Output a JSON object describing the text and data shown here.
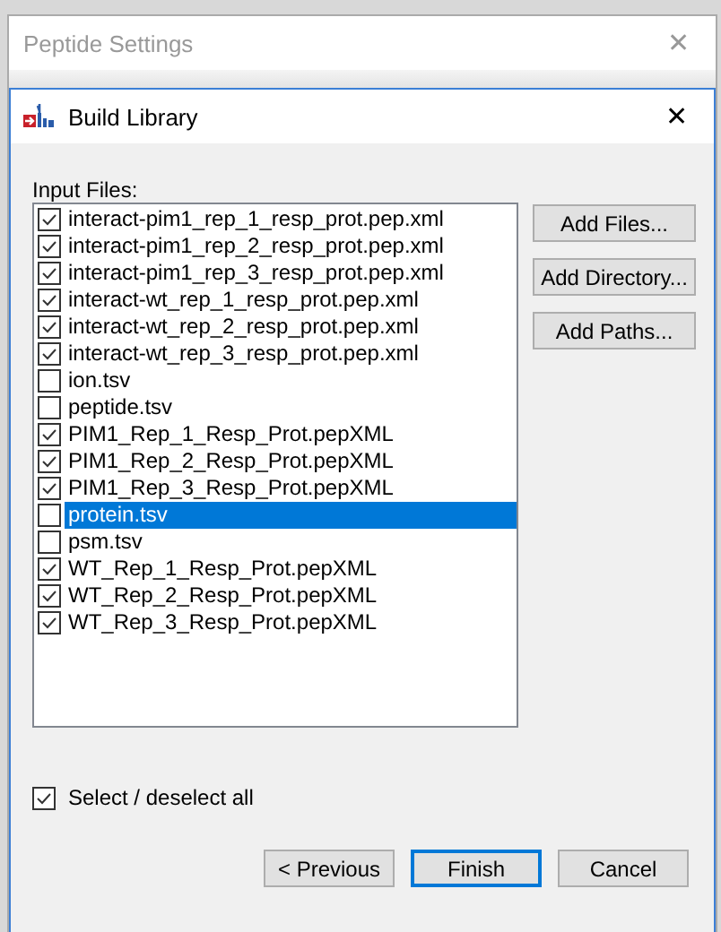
{
  "outer_window": {
    "title": "Peptide Settings",
    "close": "✕"
  },
  "dialog": {
    "title": "Build Library",
    "close": "✕"
  },
  "input_files": {
    "label": "Input Files:",
    "items": [
      {
        "name": "interact-pim1_rep_1_resp_prot.pep.xml",
        "checked": true,
        "selected": false
      },
      {
        "name": "interact-pim1_rep_2_resp_prot.pep.xml",
        "checked": true,
        "selected": false
      },
      {
        "name": "interact-pim1_rep_3_resp_prot.pep.xml",
        "checked": true,
        "selected": false
      },
      {
        "name": "interact-wt_rep_1_resp_prot.pep.xml",
        "checked": true,
        "selected": false
      },
      {
        "name": "interact-wt_rep_2_resp_prot.pep.xml",
        "checked": true,
        "selected": false
      },
      {
        "name": "interact-wt_rep_3_resp_prot.pep.xml",
        "checked": true,
        "selected": false
      },
      {
        "name": "ion.tsv",
        "checked": false,
        "selected": false
      },
      {
        "name": "peptide.tsv",
        "checked": false,
        "selected": false
      },
      {
        "name": "PIM1_Rep_1_Resp_Prot.pepXML",
        "checked": true,
        "selected": false
      },
      {
        "name": "PIM1_Rep_2_Resp_Prot.pepXML",
        "checked": true,
        "selected": false
      },
      {
        "name": "PIM1_Rep_3_Resp_Prot.pepXML",
        "checked": true,
        "selected": false
      },
      {
        "name": "protein.tsv",
        "checked": false,
        "selected": true
      },
      {
        "name": "psm.tsv",
        "checked": false,
        "selected": false
      },
      {
        "name": "WT_Rep_1_Resp_Prot.pepXML",
        "checked": true,
        "selected": false
      },
      {
        "name": "WT_Rep_2_Resp_Prot.pepXML",
        "checked": true,
        "selected": false
      },
      {
        "name": "WT_Rep_3_Resp_Prot.pepXML",
        "checked": true,
        "selected": false
      }
    ]
  },
  "side_buttons": [
    "Add Files...",
    "Add Directory...",
    "Add Paths..."
  ],
  "select_all": {
    "label": "Select / deselect all",
    "checked": true
  },
  "footer_buttons": [
    {
      "label": "< Previous",
      "default": false
    },
    {
      "label": "Finish",
      "default": true
    },
    {
      "label": "Cancel",
      "default": false
    }
  ]
}
